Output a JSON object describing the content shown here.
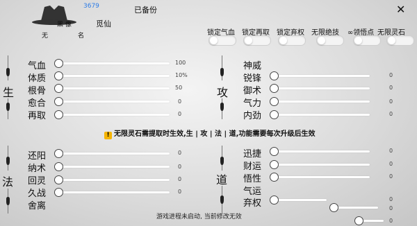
{
  "header": {
    "fps": "3679",
    "yxian": "觅仙",
    "saved": "已备份",
    "logo_top": "黑  像",
    "logo_left": "无",
    "logo_right": "名",
    "close": "✕"
  },
  "toggles": [
    {
      "label": "锁定气血"
    },
    {
      "label": "锁定再取"
    },
    {
      "label": "锁定弃权"
    },
    {
      "label": "无限绝技"
    },
    {
      "label": "∞领悟点"
    },
    {
      "label": "无限灵石"
    }
  ],
  "sections": {
    "sheng": "生",
    "gong": "攻",
    "fa": "法",
    "dao": "道"
  },
  "sheng_rows": [
    {
      "label": "气血",
      "value": "100"
    },
    {
      "label": "体质",
      "value": "10%"
    },
    {
      "label": "根骨",
      "value": "50"
    },
    {
      "label": "愈合",
      "value": "0"
    },
    {
      "label": "再取",
      "value": "0"
    }
  ],
  "gong_rows": [
    {
      "label": "神威",
      "value": ""
    },
    {
      "label": "锐锋",
      "value": "0"
    },
    {
      "label": "御术",
      "value": "0"
    },
    {
      "label": "气力",
      "value": "0"
    },
    {
      "label": "内劲",
      "value": "0"
    }
  ],
  "fa_rows": [
    {
      "label": "还阳",
      "value": "0"
    },
    {
      "label": "纳术",
      "value": "0"
    },
    {
      "label": "回灵",
      "value": "0"
    },
    {
      "label": "久战",
      "value": "0"
    },
    {
      "label": "舍离",
      "value": ""
    }
  ],
  "dao_rows": [
    {
      "label": "迅捷",
      "value": "0"
    },
    {
      "label": "财运",
      "value": "0"
    },
    {
      "label": "悟性",
      "value": "0"
    },
    {
      "label": "气运",
      "value": ""
    },
    {
      "label": "弃权",
      "value": "0"
    },
    {
      "label": "",
      "value": "0"
    },
    {
      "label": "",
      "value": "0"
    }
  ],
  "notice": "无限灵石需提取时生效,生 | 攻 | 法 | 道,功能需要每次升级后生效",
  "notice_icon": "warning-icon",
  "status": "游戏进程未启动, 当前修改无效"
}
